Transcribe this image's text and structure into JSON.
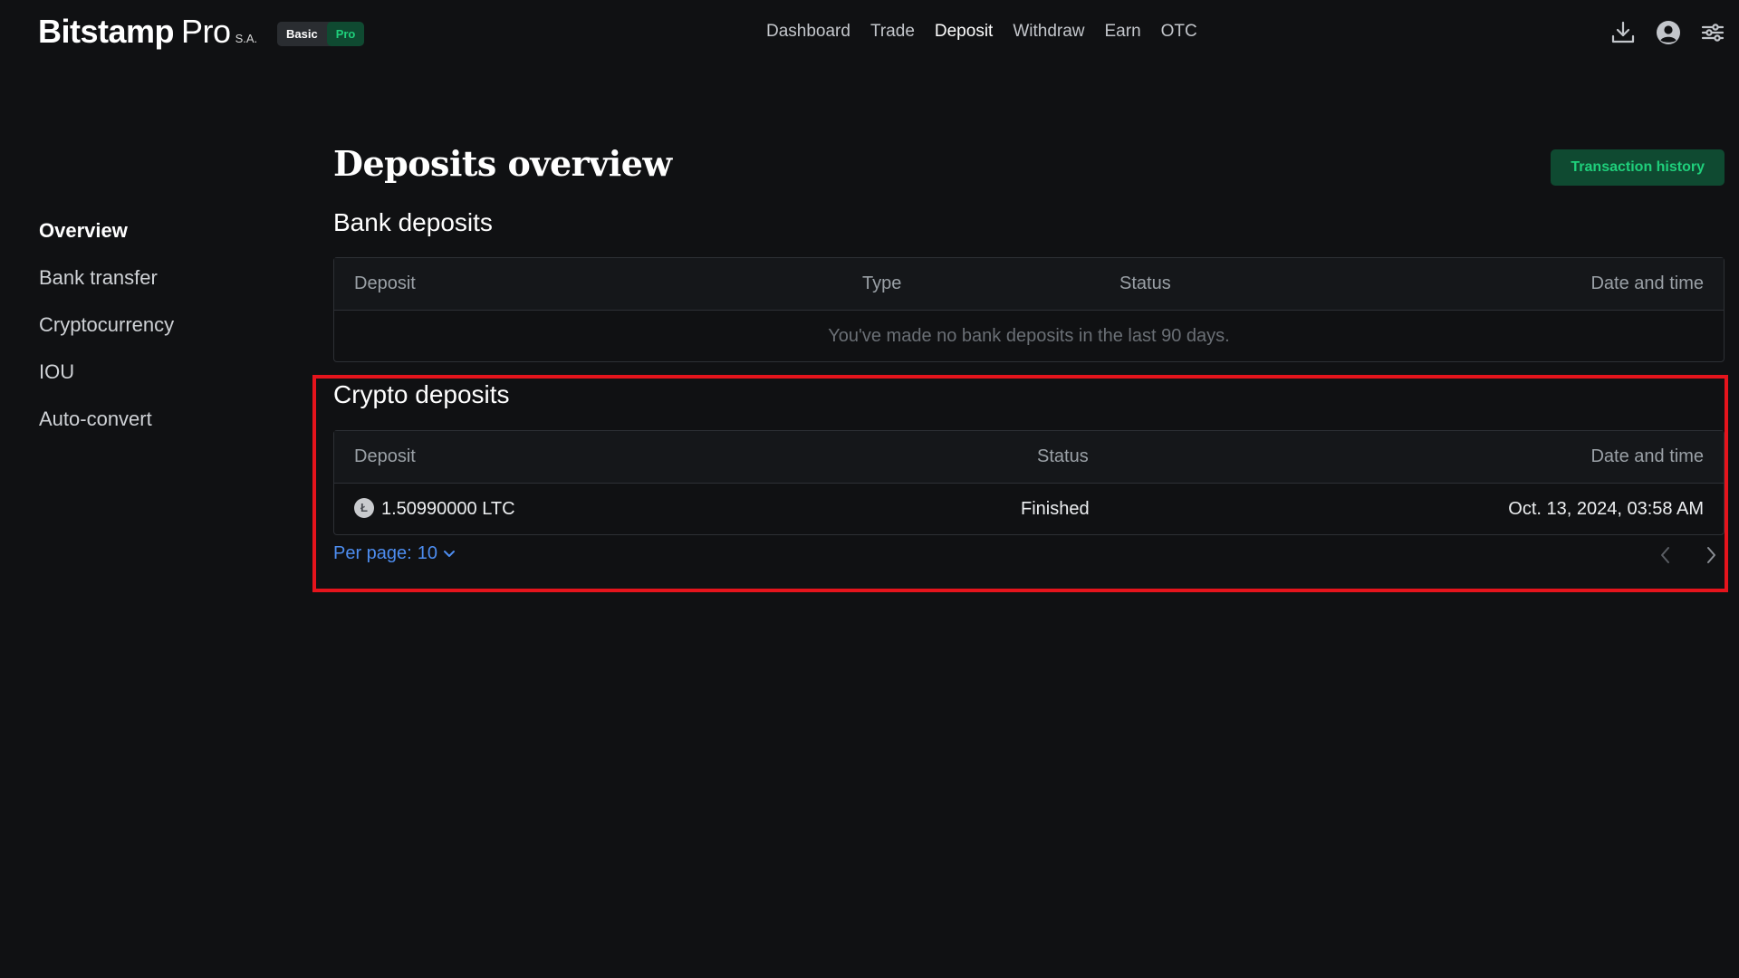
{
  "header": {
    "logo_main": "Bitstamp",
    "logo_pro": "Pro",
    "logo_suffix": "S.A.",
    "mode_basic": "Basic",
    "mode_pro": "Pro",
    "nav": [
      "Dashboard",
      "Trade",
      "Deposit",
      "Withdraw",
      "Earn",
      "OTC"
    ],
    "active_nav": "Deposit",
    "icons": [
      "download-icon",
      "user-account-icon",
      "settings-sliders-icon"
    ]
  },
  "sidebar": {
    "items": [
      "Overview",
      "Bank transfer",
      "Cryptocurrency",
      "IOU",
      "Auto-convert"
    ],
    "active": "Overview"
  },
  "main": {
    "title": "Deposits overview",
    "transaction_history_label": "Transaction history",
    "bank": {
      "title": "Bank deposits",
      "columns": [
        "Deposit",
        "Type",
        "Status",
        "Date and time"
      ],
      "empty_message": "You've made no bank deposits in the last 90 days."
    },
    "crypto": {
      "title": "Crypto deposits",
      "columns": [
        "Deposit",
        "Status",
        "Date and time"
      ],
      "rows": [
        {
          "icon": "litecoin-icon",
          "amount": "1.50990000 LTC",
          "status": "Finished",
          "datetime": "Oct. 13, 2024, 03:58 AM"
        }
      ],
      "per_page_label": "Per page:",
      "per_page_value": "10"
    }
  },
  "colors": {
    "background": "#101113",
    "accent_green": "#1fcf7b",
    "link_blue": "#4d8df0",
    "highlight_red": "#e5141c"
  }
}
